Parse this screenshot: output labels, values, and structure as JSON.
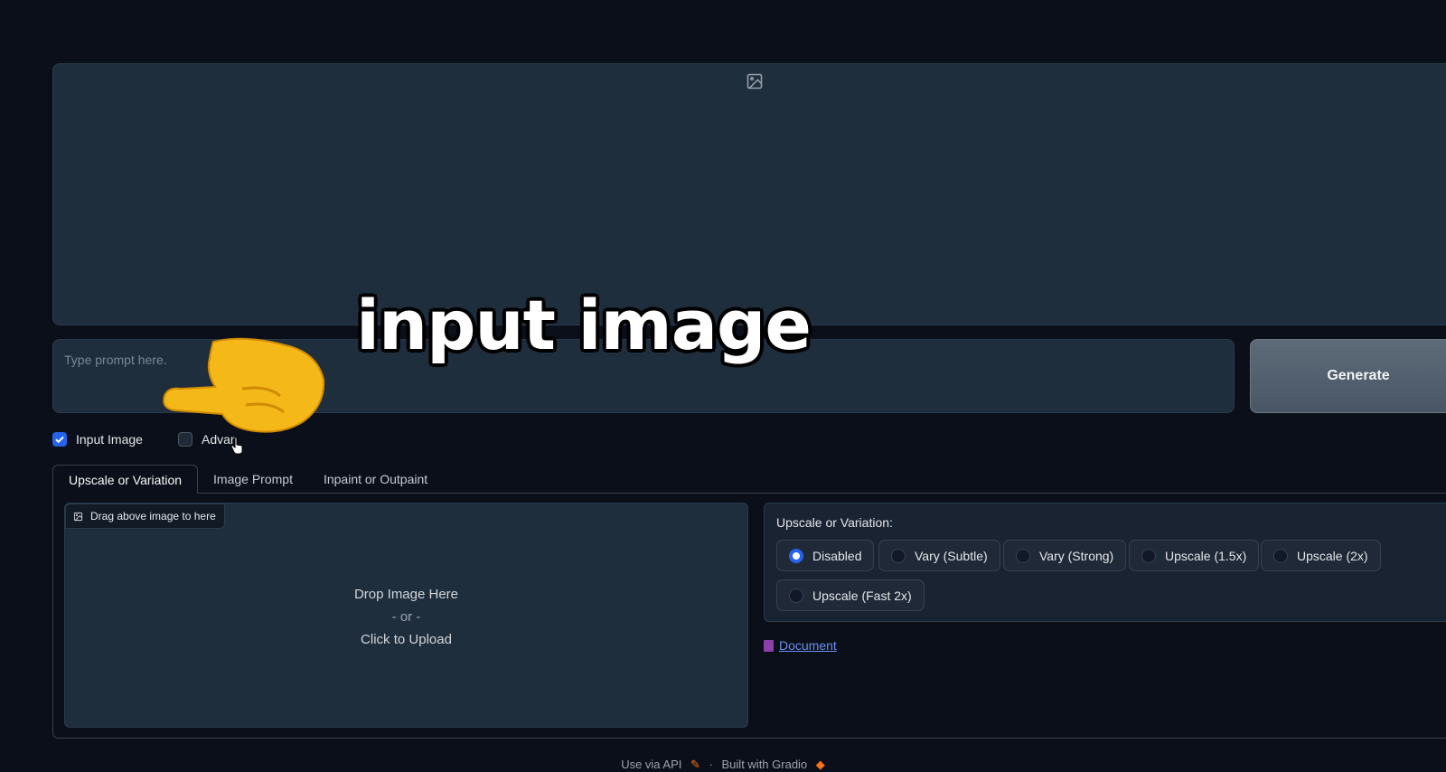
{
  "prompt": {
    "placeholder": "Type prompt here."
  },
  "generate_label": "Generate",
  "checkboxes": [
    {
      "label": "Input Image",
      "checked": true
    },
    {
      "label": "Advan",
      "checked": false
    }
  ],
  "tabs": [
    "Upscale or Variation",
    "Image Prompt",
    "Inpaint or Outpaint"
  ],
  "dropzone": {
    "badge": "Drag above image to here",
    "line1": "Drop Image Here",
    "line2": "- or -",
    "line3": "Click to Upload"
  },
  "options": {
    "title": "Upscale or Variation:",
    "items": [
      "Disabled",
      "Vary (Subtle)",
      "Vary (Strong)",
      "Upscale (1.5x)",
      "Upscale (2x)",
      "Upscale (Fast 2x)"
    ],
    "selected": "Disabled"
  },
  "doc_link": "Document",
  "footer": {
    "api": "Use via API",
    "sep": "·",
    "built": "Built with Gradio"
  },
  "overlay_caption": "input image",
  "colors": {
    "accent": "#2563eb",
    "background": "#0b0f19",
    "panel": "#1f2e3d"
  }
}
